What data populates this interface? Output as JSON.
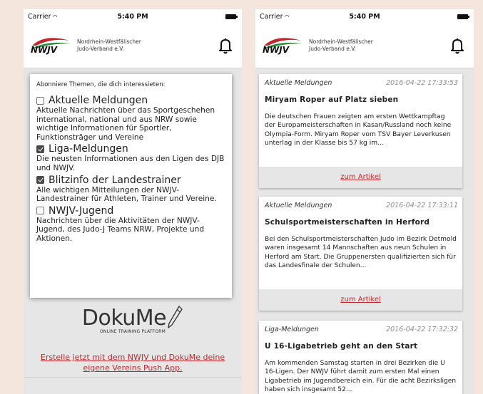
{
  "status": {
    "carrier": "Carrier",
    "time": "5:40 PM"
  },
  "header": {
    "logo_text": "NWJV",
    "org_line1": "Nordrhein-Westfälischer",
    "org_line2": "Judo-Verband e.V."
  },
  "topics": {
    "intro": "Abonniere Themen, die dich interessieten:",
    "items": [
      {
        "label": "Aktuelle Meldungen",
        "checked": false,
        "description": "Aktuelle Nachrichten über das Sportgeschehen international, national und aus NRW sowie wichtige Informationen für Sportler, Funktionsträger und Vereine"
      },
      {
        "label": "Liga-Meldungen",
        "checked": true,
        "description": "Die neusten Informationen aus den Ligen des DJB und NWJV."
      },
      {
        "label": "Blitzinfo der Landestrainer",
        "checked": true,
        "description": "Alle wichtigen Mitteilungen der NWJV-Landestrainer für Athleten, Trainer und Vereine."
      },
      {
        "label": "NWJV-Jugend",
        "checked": false,
        "description": "Nachrichten über die Aktivitäten der NWJV-Jugend, des Judo-J Teams NRW, Projekte und Aktionen."
      }
    ]
  },
  "dokume": {
    "logo": "DokuMe",
    "tagline": "ONLINE TRAINING PLATFORM",
    "promo": "Erstelle jetzt mit dem NWJV und DokuMe deine eigene Vereins Push App."
  },
  "news": [
    {
      "category": "Aktuelle Meldungen",
      "date": "2016-04-22 17:33:53",
      "title": "Miryam Roper auf Platz sieben",
      "body": "Die deutschen Frauen zeigten am ersten Wettkampftag der Europameisterschaften in Kasan/Russland noch keine Olympia-Form. Miryam Roper vom TSV Bayer Leverkusen unterlag in der Klasse bis 57 kg im...",
      "link": "zum Artikel"
    },
    {
      "category": "Aktuelle Meldungen",
      "date": "2016-04-22 17:33:11",
      "title": "Schulsportmeisterschaften in Herford",
      "body": "Bei den Schulsportmeisterschaften Judo im Bezirk Detmold waren insgesamt 14 Mannschaften aus neun Schulen in Herford am Start. Die Gruppenersten qualifizierten sich für das Landesfinale der Schulen...",
      "link": "zum Artikel"
    },
    {
      "category": "Liga-Meldungen",
      "date": "2016-04-22 17:32:32",
      "title": "U 16-Ligabetrieb geht an den Start",
      "body": "Am kommenden Samstag starten in drei Bezirken die U 16-Ligen. Der NWJV führt damit zum ersten Mal einen Ligabetrieb im Jugendbereich ein. Für die acht Bezirksligen haben sich insgesamt 52...",
      "link": ""
    }
  ],
  "colors": {
    "brand_red": "#c0282d",
    "brand_green": "#2e8b3a",
    "background": "#f4e6dc"
  }
}
